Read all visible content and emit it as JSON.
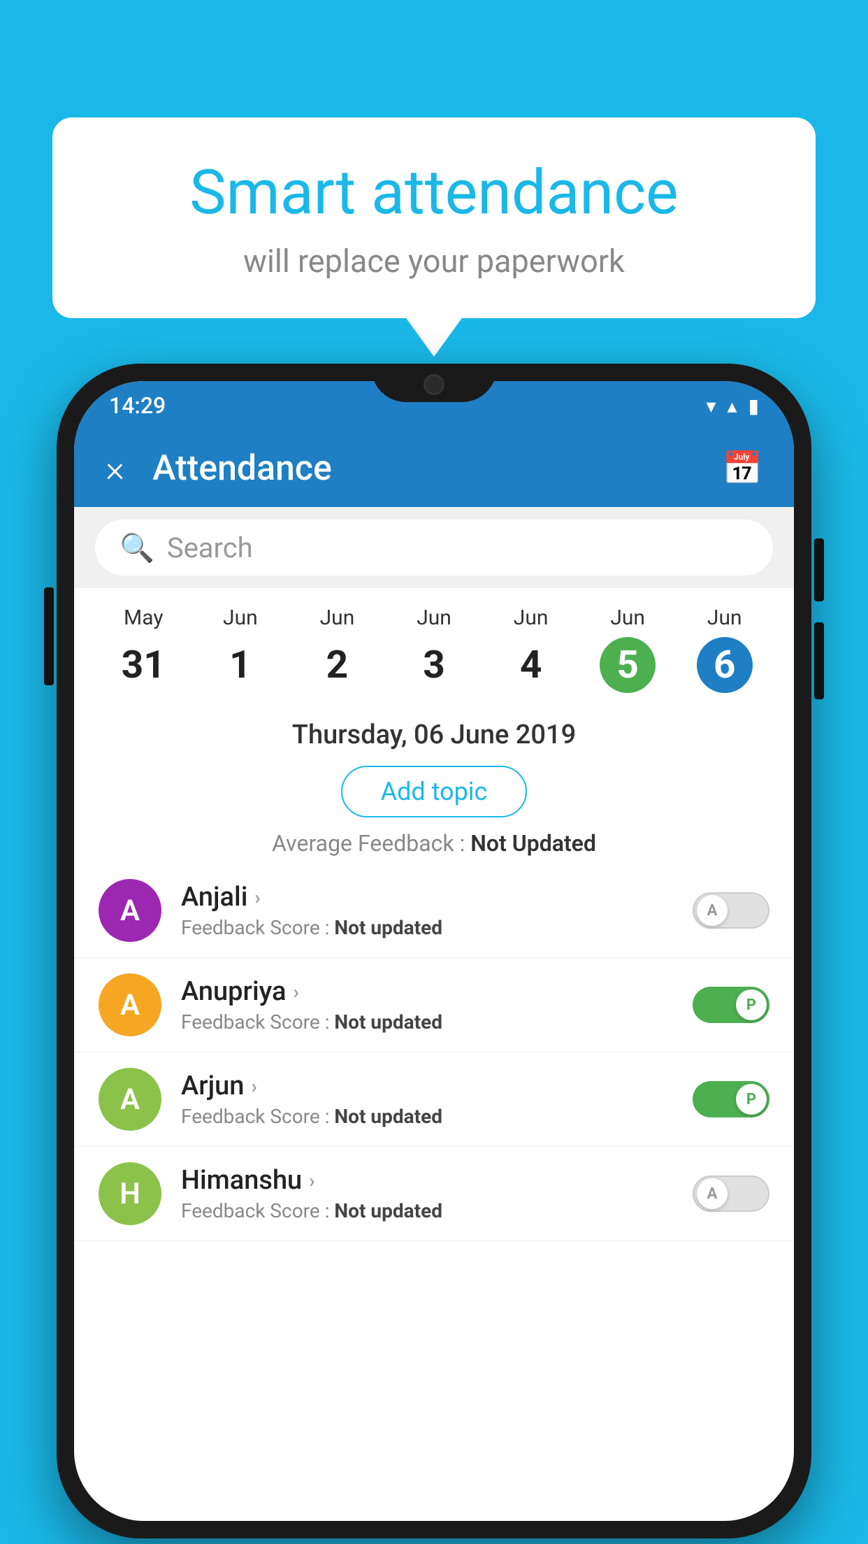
{
  "background": {
    "color": "#1ab8e8"
  },
  "speech_bubble": {
    "title": "Smart attendance",
    "subtitle": "will replace your paperwork"
  },
  "status_bar": {
    "time": "14:29",
    "wifi_icon": "▼",
    "signal_icon": "▲",
    "battery_icon": "▮"
  },
  "app_bar": {
    "title": "Attendance",
    "close_label": "×",
    "calendar_icon": "📅"
  },
  "search": {
    "placeholder": "Search"
  },
  "calendar": {
    "columns": [
      {
        "month": "May",
        "day": "31",
        "style": "normal"
      },
      {
        "month": "Jun",
        "day": "1",
        "style": "normal"
      },
      {
        "month": "Jun",
        "day": "2",
        "style": "normal"
      },
      {
        "month": "Jun",
        "day": "3",
        "style": "normal"
      },
      {
        "month": "Jun",
        "day": "4",
        "style": "normal"
      },
      {
        "month": "Jun",
        "day": "5",
        "style": "selected-green"
      },
      {
        "month": "Jun",
        "day": "6",
        "style": "selected-blue"
      }
    ],
    "selected_date": "Thursday, 06 June 2019"
  },
  "add_topic_button": "Add topic",
  "average_feedback": {
    "label": "Average Feedback : ",
    "value": "Not Updated"
  },
  "students": [
    {
      "name": "Anjali",
      "avatar_letter": "A",
      "avatar_color": "#9c27b0",
      "feedback": "Feedback Score : ",
      "feedback_value": "Not updated",
      "toggle": "off",
      "toggle_label": "A"
    },
    {
      "name": "Anupriya",
      "avatar_letter": "A",
      "avatar_color": "#f5a623",
      "feedback": "Feedback Score : ",
      "feedback_value": "Not updated",
      "toggle": "on",
      "toggle_label": "P"
    },
    {
      "name": "Arjun",
      "avatar_letter": "A",
      "avatar_color": "#8bc34a",
      "feedback": "Feedback Score : ",
      "feedback_value": "Not updated",
      "toggle": "on",
      "toggle_label": "P"
    },
    {
      "name": "Himanshu",
      "avatar_letter": "H",
      "avatar_color": "#8bc34a",
      "feedback": "Feedback Score : ",
      "feedback_value": "Not updated",
      "toggle": "off",
      "toggle_label": "A"
    }
  ]
}
